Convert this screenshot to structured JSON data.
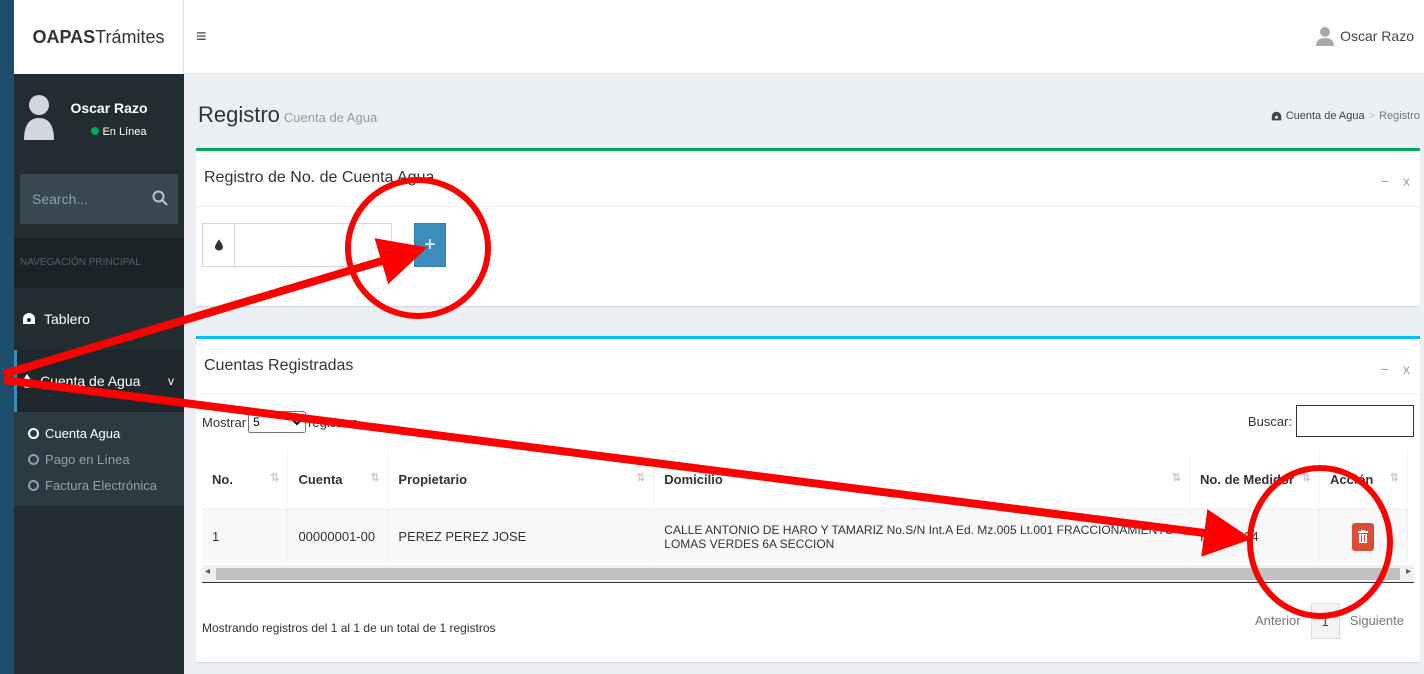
{
  "app": {
    "logo_bold": "OAPAS",
    "logo_rest": "Trámites",
    "menu_icon": "≡",
    "top_user": "Oscar Razo"
  },
  "sidebar": {
    "user_name": "Oscar Razo",
    "user_status": "En Línea",
    "search_placeholder": "Search...",
    "nav_header": "NAVEGACIÓN PRINCIPAL",
    "items": [
      {
        "label": "Tablero",
        "icon": "dashboard-icon"
      },
      {
        "label": "Cuenta de Agua",
        "icon": "water-drop-icon",
        "chevron": "v"
      }
    ],
    "subitems": [
      {
        "label": "Cuenta Agua"
      },
      {
        "label": "Pago en Línea"
      },
      {
        "label": "Factura Electrónica"
      }
    ]
  },
  "header": {
    "title": "Registro",
    "subtitle": "Cuenta de Agua",
    "breadcrumb": [
      "Cuenta de Agua",
      "Registro"
    ],
    "breadcrumb_sep": ">"
  },
  "register_box": {
    "title": "Registro de No. de Cuenta Agua",
    "minimize": "−",
    "close": "x",
    "add_label": "+",
    "input_value": ""
  },
  "accounts_box": {
    "title": "Cuentas Registradas",
    "minimize": "−",
    "close": "x",
    "show_label": "Mostrar",
    "show_value": "5",
    "show_suffix": "registros",
    "search_label": "Buscar:",
    "columns": [
      "No.",
      "Cuenta",
      "Propietario",
      "Domicilio",
      "No. de Medidor",
      "Acción"
    ],
    "rows": [
      {
        "no": "1",
        "cuenta": "00000001-00",
        "propietario": "PEREZ PEREZ JOSE",
        "domicilio": "CALLE ANTONIO DE HARO Y TAMARIZ No.S/N Int.A Ed. Mz.005 Lt.001 FRACCIONAMIENTO LOMAS VERDES 6A SECCION",
        "medidor": "KN-12624"
      }
    ],
    "info": "Mostrando registros del 1 al 1 de un total de 1 registros",
    "prev": "Anterior",
    "page": "1",
    "next": "Siguiente"
  },
  "colors": {
    "success_border": "#00a65a",
    "info_border": "#00c0ef",
    "primary": "#3c8dbc",
    "danger": "#dd4b39",
    "annotation": "#ff0000"
  }
}
